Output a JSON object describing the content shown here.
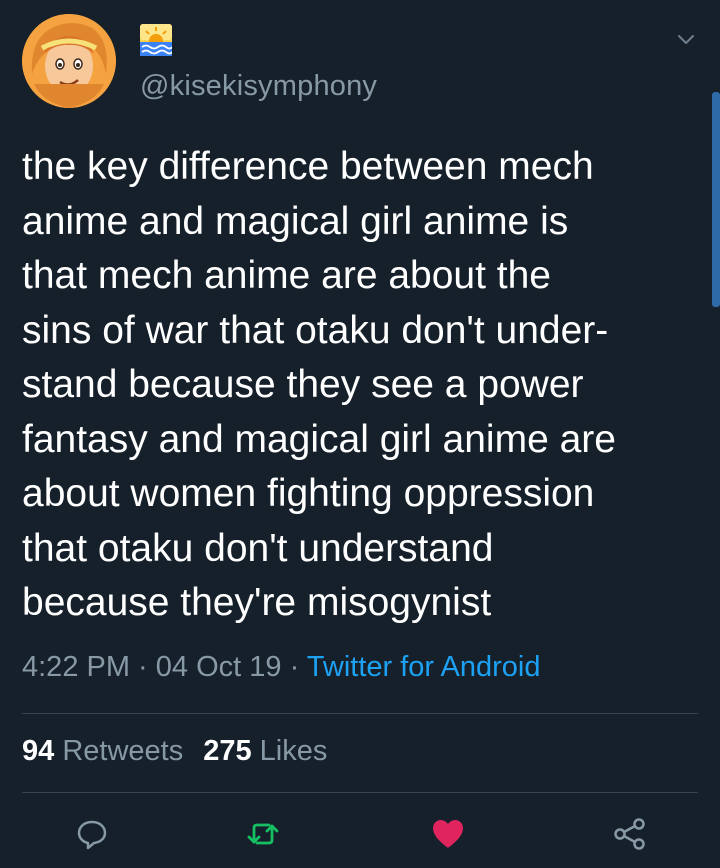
{
  "author": {
    "handle": "@kisekisymphony",
    "display_name_icon": "sunrise-over-water-icon"
  },
  "tweet": {
    "lines": [
      "the key difference between mech",
      "anime and magical girl anime is",
      "that mech anime are about the",
      "sins of war that otaku don't under-",
      "stand because they see a power",
      "fantasy and magical girl anime are",
      "about women fighting oppression",
      "that otaku don't understand",
      "because they're misogynist"
    ]
  },
  "meta": {
    "time": "4:22 PM",
    "separator": " · ",
    "date": "04 Oct 19",
    "source": "Twitter for Android"
  },
  "stats": {
    "retweets_count": "94",
    "retweets_label": "Retweets",
    "likes_count": "275",
    "likes_label": "Likes"
  },
  "actions": [
    {
      "name": "reply",
      "icon": "speech-bubble-icon"
    },
    {
      "name": "retweet",
      "icon": "retweet-arrows-icon"
    },
    {
      "name": "like",
      "icon": "heart-icon"
    },
    {
      "name": "share",
      "icon": "share-nodes-icon"
    }
  ],
  "colors": {
    "background": "#15202b",
    "primary_text": "#ffffff",
    "secondary_text": "#8899a6",
    "link": "#1da1f2",
    "retweet_icon": "#17bf63",
    "like_icon": "#e0245e",
    "divider": "#38444d"
  }
}
